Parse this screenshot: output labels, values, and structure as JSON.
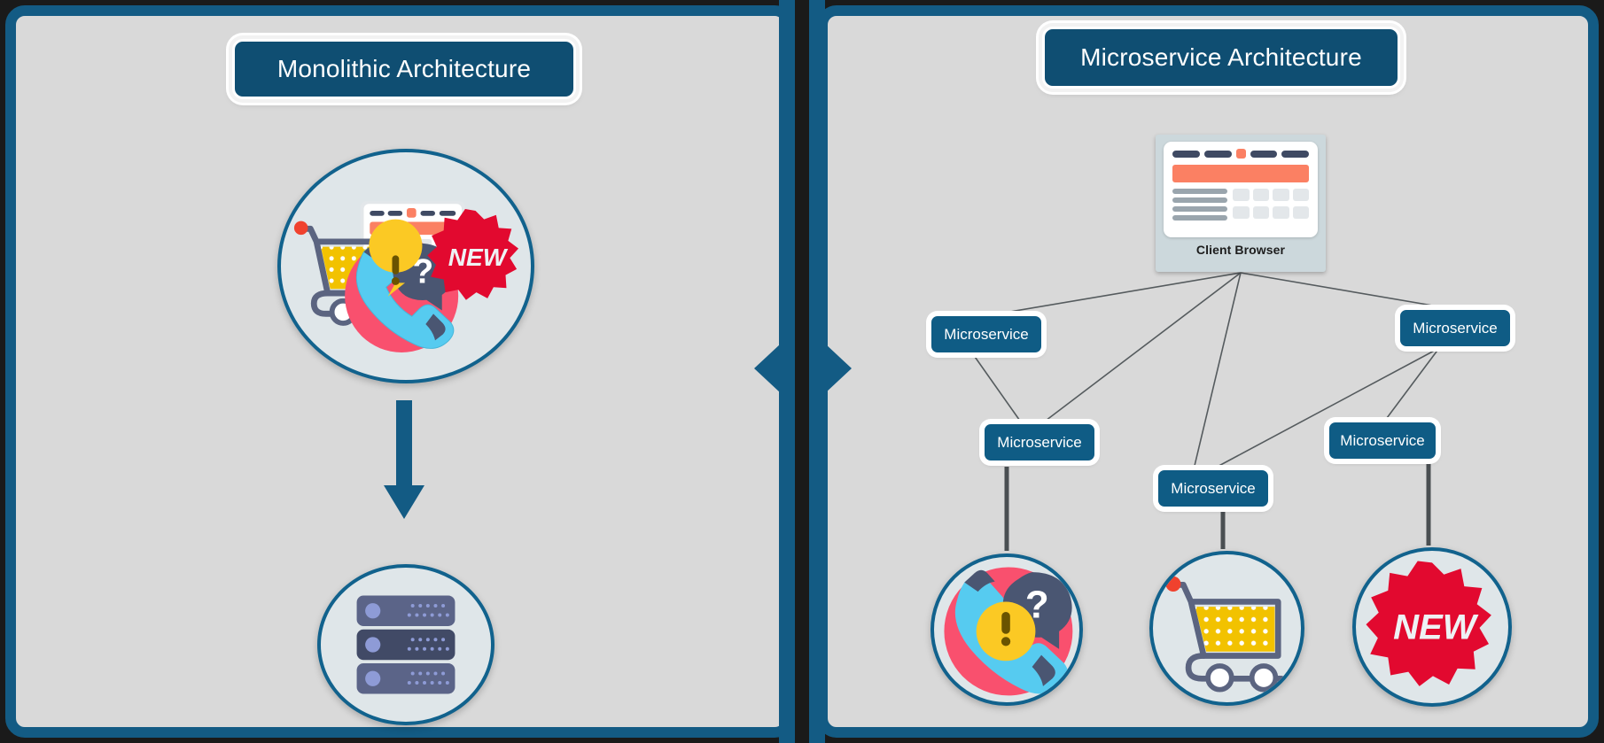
{
  "theme": {
    "frame_border": "#135b84",
    "panel_bg": "#d9d9d9",
    "badge_fill": "#0f4e72",
    "node_fill": "#0f5c85",
    "accent_orange": "#fb8063",
    "accent_red": "#e2092f",
    "accent_yellow": "#f2c200",
    "accent_pink": "#f9506e",
    "accent_cyan": "#56cbf0",
    "navy_dark": "#3f4a63",
    "edge_gray": "#555b5e"
  },
  "left_panel": {
    "title": "Monolithic Architecture",
    "app_circle_name": "monolithic-application",
    "arrow_name": "deploy-arrow-down",
    "database_name": "single-server-database",
    "icons_inside": [
      "browser-window-icon",
      "shopping-cart-icon",
      "support-phone-icon",
      "new-badge-icon"
    ],
    "new_badge_text": "NEW"
  },
  "right_panel": {
    "title": "Microservice Architecture",
    "client": {
      "label": "Client Browser",
      "icon": "browser-window-icon"
    },
    "services": [
      {
        "id": "ms-1",
        "label": "Microservice"
      },
      {
        "id": "ms-2",
        "label": "Microservice"
      },
      {
        "id": "ms-3",
        "label": "Microservice"
      },
      {
        "id": "ms-4",
        "label": "Microservice"
      },
      {
        "id": "ms-5",
        "label": "Microservice"
      }
    ],
    "service_circles": [
      {
        "id": "circle-support",
        "icon": "support-phone-icon"
      },
      {
        "id": "circle-cart",
        "icon": "shopping-cart-icon"
      },
      {
        "id": "circle-new",
        "icon": "new-badge-icon",
        "text": "NEW"
      }
    ],
    "edges": [
      {
        "from": "client-browser",
        "to": "ms-1"
      },
      {
        "from": "client-browser",
        "to": "ms-3"
      },
      {
        "from": "client-browser",
        "to": "ms-4"
      },
      {
        "from": "client-browser",
        "to": "ms-2"
      },
      {
        "from": "ms-1",
        "to": "ms-3"
      },
      {
        "from": "ms-2",
        "to": "ms-5"
      },
      {
        "from": "ms-2",
        "to": "ms-4"
      },
      {
        "from": "ms-3",
        "to": "circle-support"
      },
      {
        "from": "ms-4",
        "to": "circle-cart"
      },
      {
        "from": "ms-5",
        "to": "circle-new"
      }
    ]
  },
  "divider": {
    "name": "panel-divider",
    "left_chevron": "chevron-left-icon",
    "right_chevron": "chevron-right-icon"
  }
}
